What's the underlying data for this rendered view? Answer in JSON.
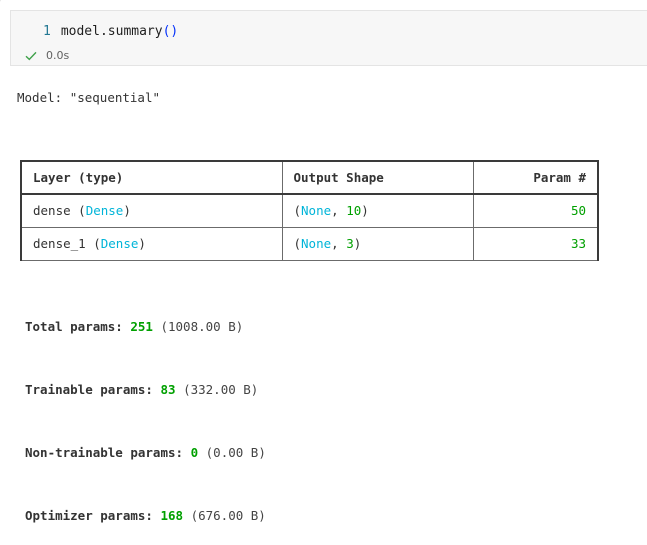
{
  "cell": {
    "line_number": "1",
    "code_object": "model",
    "code_dot": ".",
    "code_function": "summary",
    "code_parens": "()",
    "exec_time": "0.0s"
  },
  "model_line": {
    "prefix": "Model: ",
    "name": "\"sequential\""
  },
  "table": {
    "headers": [
      "Layer (type)",
      "Output Shape",
      "Param #"
    ],
    "rows": [
      {
        "layer_name": "dense",
        "layer_type": "Dense",
        "shape_none": "None",
        "shape_dim": "10",
        "params": "50"
      },
      {
        "layer_name": "dense_1",
        "layer_type": "Dense",
        "shape_none": "None",
        "shape_dim": "3",
        "params": "33"
      }
    ]
  },
  "params": [
    {
      "label": "Total params:",
      "value": "251",
      "size": "(1008.00 B)"
    },
    {
      "label": "Trainable params:",
      "value": "83",
      "size": "(332.00 B)"
    },
    {
      "label": "Non-trainable params:",
      "value": "0",
      "size": "(0.00 B)"
    },
    {
      "label": "Optimizer params:",
      "value": "168",
      "size": "(676.00 B)"
    }
  ],
  "colors": {
    "type_highlight": "#00b4d8",
    "number_highlight": "#00a000",
    "success_check": "#3fa14a"
  },
  "icons": {
    "exec_status": "check-icon"
  }
}
